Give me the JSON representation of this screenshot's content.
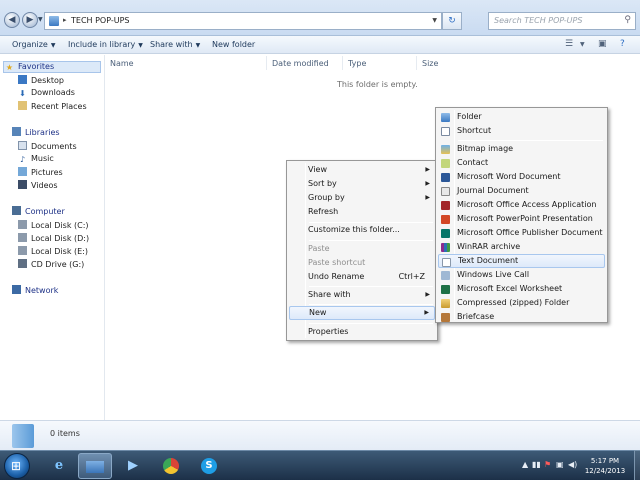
{
  "window": {
    "path": "TECH POP-UPS",
    "search_placeholder": "Search TECH POP-UPS"
  },
  "toolbar": {
    "organize": "Organize",
    "include": "Include in library",
    "share": "Share with",
    "newfolder": "New folder"
  },
  "nav": {
    "favorites": "Favorites",
    "desktop": "Desktop",
    "downloads": "Downloads",
    "recent": "Recent Places",
    "libraries": "Libraries",
    "documents": "Documents",
    "music": "Music",
    "pictures": "Pictures",
    "videos": "Videos",
    "computer": "Computer",
    "disk_c": "Local Disk (C:)",
    "disk_d": "Local Disk (D:)",
    "disk_e": "Local Disk (E:)",
    "cd": "CD Drive (G:)",
    "network": "Network"
  },
  "columns": {
    "name": "Name",
    "date": "Date modified",
    "type": "Type",
    "size": "Size"
  },
  "content": {
    "empty": "This folder is empty."
  },
  "details": {
    "count": "0 items"
  },
  "context_menu": {
    "view": "View",
    "sortby": "Sort by",
    "groupby": "Group by",
    "refresh": "Refresh",
    "customize": "Customize this folder...",
    "paste": "Paste",
    "paste_shortcut": "Paste shortcut",
    "undo": "Undo Rename",
    "undo_shortcut": "Ctrl+Z",
    "share": "Share with",
    "new": "New",
    "properties": "Properties"
  },
  "new_menu": {
    "folder": "Folder",
    "shortcut": "Shortcut",
    "bitmap": "Bitmap image",
    "contact": "Contact",
    "word": "Microsoft Word Document",
    "journal": "Journal Document",
    "access": "Microsoft Office Access Application",
    "powerpoint": "Microsoft PowerPoint Presentation",
    "publisher": "Microsoft Office Publisher Document",
    "winrar": "WinRAR archive",
    "text": "Text Document",
    "livecall": "Windows Live Call",
    "excel": "Microsoft Excel Worksheet",
    "zip": "Compressed (zipped) Folder",
    "briefcase": "Briefcase"
  },
  "taskbar": {
    "time": "5:17 PM",
    "date": "12/24/2013"
  },
  "colors": {
    "highlight_border": "#a8c7ee",
    "taskbar": "#1c3048"
  }
}
